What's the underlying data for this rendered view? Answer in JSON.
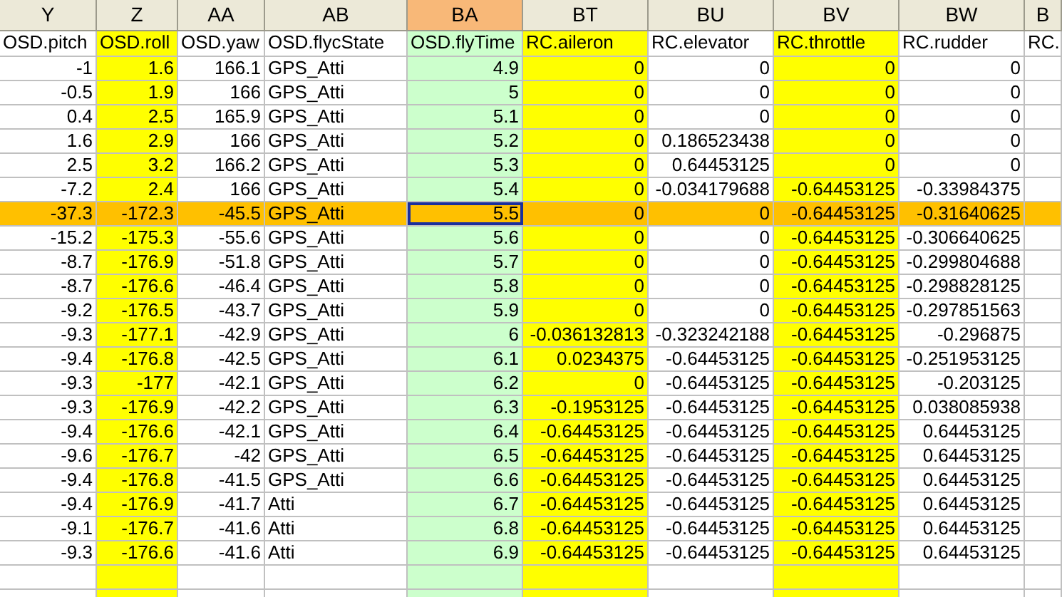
{
  "columns": [
    {
      "letter": "Y",
      "name": "OSD.pitch",
      "kind": "number",
      "selected": false
    },
    {
      "letter": "Z",
      "name": "OSD.roll",
      "kind": "number",
      "selected": false,
      "color": "#ffff00"
    },
    {
      "letter": "AA",
      "name": "OSD.yaw",
      "kind": "number",
      "selected": false
    },
    {
      "letter": "AB",
      "name": "OSD.flycState",
      "kind": "text",
      "selected": false
    },
    {
      "letter": "BA",
      "name": "OSD.flyTime",
      "kind": "number",
      "selected": true,
      "color": "#ccffcc"
    },
    {
      "letter": "BT",
      "name": "RC.aileron",
      "kind": "number",
      "selected": false,
      "color": "#ffff00"
    },
    {
      "letter": "BU",
      "name": "RC.elevator",
      "kind": "number",
      "selected": false
    },
    {
      "letter": "BV",
      "name": "RC.throttle",
      "kind": "number",
      "selected": false,
      "color": "#ffff00"
    },
    {
      "letter": "BW",
      "name": "RC.rudder",
      "kind": "number",
      "selected": false
    },
    {
      "letter": "B",
      "name": "RC.",
      "kind": "number",
      "selected": false
    }
  ],
  "rows": [
    {
      "selected": false,
      "cells": [
        "-1",
        "1.6",
        "166.1",
        "GPS_Atti",
        "4.9",
        "0",
        "0",
        "0",
        "0"
      ]
    },
    {
      "selected": false,
      "cells": [
        "-0.5",
        "1.9",
        "166",
        "GPS_Atti",
        "5",
        "0",
        "0",
        "0",
        "0"
      ]
    },
    {
      "selected": false,
      "cells": [
        "0.4",
        "2.5",
        "165.9",
        "GPS_Atti",
        "5.1",
        "0",
        "0",
        "0",
        "0"
      ]
    },
    {
      "selected": false,
      "cells": [
        "1.6",
        "2.9",
        "166",
        "GPS_Atti",
        "5.2",
        "0",
        "0.186523438",
        "0",
        "0"
      ]
    },
    {
      "selected": false,
      "cells": [
        "2.5",
        "3.2",
        "166.2",
        "GPS_Atti",
        "5.3",
        "0",
        "0.64453125",
        "0",
        "0"
      ]
    },
    {
      "selected": false,
      "cells": [
        "-7.2",
        "2.4",
        "166",
        "GPS_Atti",
        "5.4",
        "0",
        "-0.034179688",
        "-0.64453125",
        "-0.33984375"
      ]
    },
    {
      "selected": true,
      "cells": [
        "-37.3",
        "-172.3",
        "-45.5",
        "GPS_Atti",
        "5.5",
        "0",
        "0",
        "-0.64453125",
        "-0.31640625"
      ]
    },
    {
      "selected": false,
      "cells": [
        "-15.2",
        "-175.3",
        "-55.6",
        "GPS_Atti",
        "5.6",
        "0",
        "0",
        "-0.64453125",
        "-0.306640625"
      ]
    },
    {
      "selected": false,
      "cells": [
        "-8.7",
        "-176.9",
        "-51.8",
        "GPS_Atti",
        "5.7",
        "0",
        "0",
        "-0.64453125",
        "-0.299804688"
      ]
    },
    {
      "selected": false,
      "cells": [
        "-8.7",
        "-176.6",
        "-46.4",
        "GPS_Atti",
        "5.8",
        "0",
        "0",
        "-0.64453125",
        "-0.298828125"
      ]
    },
    {
      "selected": false,
      "cells": [
        "-9.2",
        "-176.5",
        "-43.7",
        "GPS_Atti",
        "5.9",
        "0",
        "0",
        "-0.64453125",
        "-0.297851563"
      ]
    },
    {
      "selected": false,
      "cells": [
        "-9.3",
        "-177.1",
        "-42.9",
        "GPS_Atti",
        "6",
        "-0.036132813",
        "-0.323242188",
        "-0.64453125",
        "-0.296875"
      ]
    },
    {
      "selected": false,
      "cells": [
        "-9.4",
        "-176.8",
        "-42.5",
        "GPS_Atti",
        "6.1",
        "0.0234375",
        "-0.64453125",
        "-0.64453125",
        "-0.251953125"
      ]
    },
    {
      "selected": false,
      "cells": [
        "-9.3",
        "-177",
        "-42.1",
        "GPS_Atti",
        "6.2",
        "0",
        "-0.64453125",
        "-0.64453125",
        "-0.203125"
      ]
    },
    {
      "selected": false,
      "cells": [
        "-9.3",
        "-176.9",
        "-42.2",
        "GPS_Atti",
        "6.3",
        "-0.1953125",
        "-0.64453125",
        "-0.64453125",
        "0.038085938"
      ]
    },
    {
      "selected": false,
      "cells": [
        "-9.4",
        "-176.6",
        "-42.1",
        "GPS_Atti",
        "6.4",
        "-0.64453125",
        "-0.64453125",
        "-0.64453125",
        "0.64453125"
      ]
    },
    {
      "selected": false,
      "cells": [
        "-9.6",
        "-176.7",
        "-42",
        "GPS_Atti",
        "6.5",
        "-0.64453125",
        "-0.64453125",
        "-0.64453125",
        "0.64453125"
      ]
    },
    {
      "selected": false,
      "cells": [
        "-9.4",
        "-176.8",
        "-41.5",
        "GPS_Atti",
        "6.6",
        "-0.64453125",
        "-0.64453125",
        "-0.64453125",
        "0.64453125"
      ]
    },
    {
      "selected": false,
      "cells": [
        "-9.4",
        "-176.9",
        "-41.7",
        "Atti",
        "6.7",
        "-0.64453125",
        "-0.64453125",
        "-0.64453125",
        "0.64453125"
      ]
    },
    {
      "selected": false,
      "cells": [
        "-9.1",
        "-176.7",
        "-41.6",
        "Atti",
        "6.8",
        "-0.64453125",
        "-0.64453125",
        "-0.64453125",
        "0.64453125"
      ]
    },
    {
      "selected": false,
      "cells": [
        "-9.3",
        "-176.6",
        "-41.6",
        "Atti",
        "6.9",
        "-0.64453125",
        "-0.64453125",
        "-0.64453125",
        "0.64453125"
      ]
    }
  ]
}
